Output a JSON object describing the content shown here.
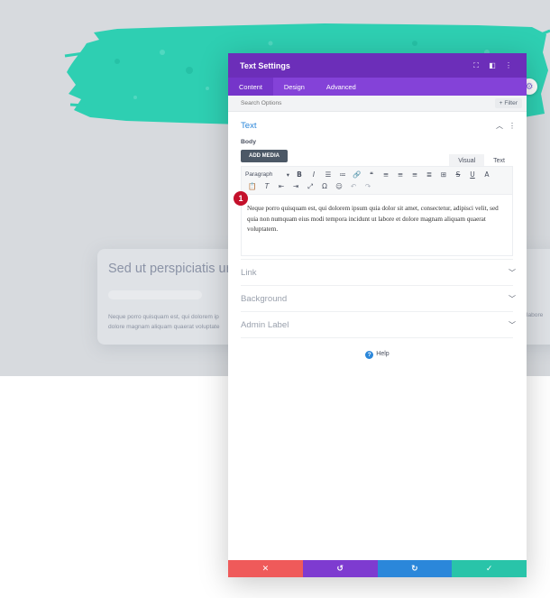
{
  "background": {
    "card_title": "Sed ut perspiciatis ur",
    "card_text": "Neque porro quisquam est, qui dolorem ip",
    "card_text_2": "dolore magnam aliquam quaerat voluptate",
    "right_text": "labore"
  },
  "modal": {
    "title": "Text Settings",
    "tabs": [
      {
        "label": "Content",
        "active": true
      },
      {
        "label": "Design",
        "active": false
      },
      {
        "label": "Advanced",
        "active": false
      }
    ],
    "search_placeholder": "Search Options",
    "filter_label": "+ Filter"
  },
  "text_section": {
    "title": "Text",
    "body_label": "Body",
    "add_media_label": "ADD MEDIA",
    "visual_tab": "Visual",
    "text_tab": "Text",
    "paragraph_select": "Paragraph",
    "content": "Neque porro quisquam est, qui dolorem ipsum quia dolor sit amet, consectetur, adipisci velit, sed quia non numquam eius modi tempora incidunt ut labore et dolore magnam aliquam quaerat voluptatem."
  },
  "sections": {
    "link": "Link",
    "background": "Background",
    "admin_label": "Admin Label"
  },
  "help_label": "Help",
  "badge_number": "1",
  "colors": {
    "header": "#6c2eb9",
    "tabs": "#8442d8",
    "accent": "#2b87da",
    "cancel": "#ef5a5a",
    "undo": "#7e3bd0",
    "redo": "#2b87da",
    "save": "#29c4a9",
    "brush": "#2ecfb2"
  },
  "icons": {
    "expand": "expand-icon",
    "columns": "columns-icon",
    "more": "more-vertical-icon",
    "cancel": "close-icon",
    "undo": "undo-icon",
    "redo": "redo-icon",
    "save": "check-icon"
  }
}
